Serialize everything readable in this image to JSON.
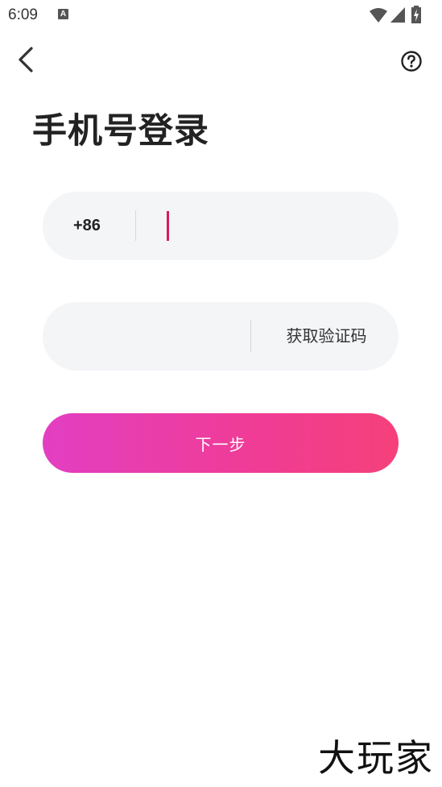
{
  "status_bar": {
    "time": "6:09",
    "notification_icon": "A",
    "icons": [
      "wifi-icon",
      "signal-icon",
      "battery-charging-icon"
    ]
  },
  "header": {
    "back_icon": "chevron-left-icon",
    "help_icon": "question-circle-icon"
  },
  "page": {
    "title": "手机号登录"
  },
  "phone_field": {
    "country_code": "+86",
    "value": "",
    "placeholder": ""
  },
  "code_field": {
    "value": "",
    "placeholder": "",
    "get_code_label": "获取验证码"
  },
  "next_button": {
    "label": "下一步"
  },
  "watermark": {
    "text": "大玩家"
  },
  "colors": {
    "caret": "#d81b60",
    "button_gradient_start": "#e23fc2",
    "button_gradient_end": "#f5407a",
    "field_background": "#f4f5f7"
  }
}
